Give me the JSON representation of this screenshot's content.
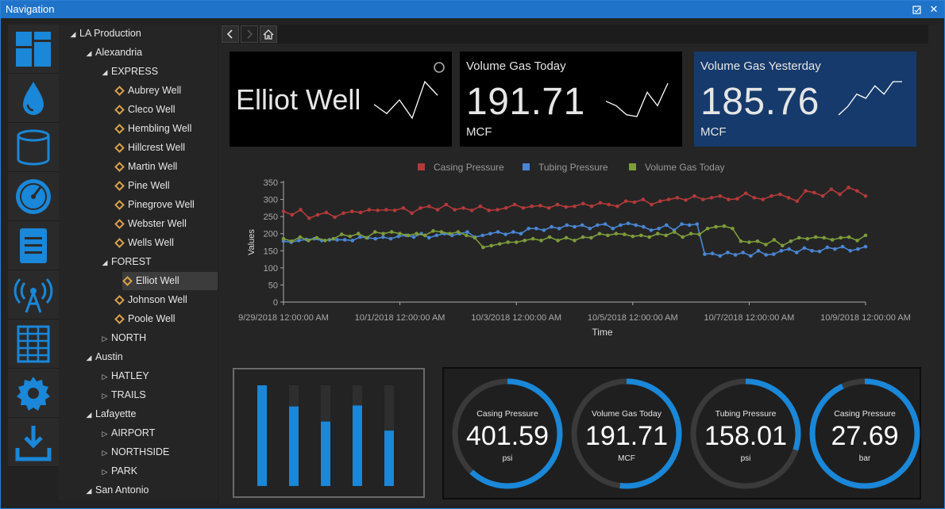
{
  "window": {
    "title": "Navigation"
  },
  "colors": {
    "accent": "#1a87d8",
    "tile_active": "#163a6b",
    "casing": "#b33a3a",
    "tubing": "#4a86d4",
    "volume": "#7e9c3a"
  },
  "sidebar": {
    "icons": [
      "dashboard-icon",
      "water-drop-icon",
      "tank-icon",
      "gauge-icon",
      "document-icon",
      "antenna-icon",
      "grid-table-icon",
      "gear-icon",
      "download-icon"
    ]
  },
  "tree": {
    "rows": [
      {
        "label": "LA Production",
        "level": 0,
        "expander": "open"
      },
      {
        "label": "Alexandria",
        "level": 1,
        "expander": "open"
      },
      {
        "label": "EXPRESS",
        "level": 2,
        "expander": "open"
      },
      {
        "label": "Aubrey Well",
        "level": 3,
        "expander": "leaf"
      },
      {
        "label": "Cleco Well",
        "level": 3,
        "expander": "leaf"
      },
      {
        "label": "Hembling Well",
        "level": 3,
        "expander": "leaf"
      },
      {
        "label": "Hillcrest Well",
        "level": 3,
        "expander": "leaf"
      },
      {
        "label": "Martin Well",
        "level": 3,
        "expander": "leaf"
      },
      {
        "label": "Pine Well",
        "level": 3,
        "expander": "leaf"
      },
      {
        "label": "Pinegrove Well",
        "level": 3,
        "expander": "leaf"
      },
      {
        "label": "Webster Well",
        "level": 3,
        "expander": "leaf"
      },
      {
        "label": "Wells Well",
        "level": 3,
        "expander": "leaf"
      },
      {
        "label": "FOREST",
        "level": 2,
        "expander": "open"
      },
      {
        "label": "Elliot Well",
        "level": 3,
        "expander": "leaf",
        "selected": true
      },
      {
        "label": "Johnson Well",
        "level": 3,
        "expander": "leaf"
      },
      {
        "label": "Poole Well",
        "level": 3,
        "expander": "leaf"
      },
      {
        "label": "NORTH",
        "level": 2,
        "expander": "closed"
      },
      {
        "label": "Austin",
        "level": 1,
        "expander": "open"
      },
      {
        "label": "HATLEY",
        "level": 2,
        "expander": "closed"
      },
      {
        "label": "TRAILS",
        "level": 2,
        "expander": "closed"
      },
      {
        "label": "Lafayette",
        "level": 1,
        "expander": "open"
      },
      {
        "label": "AIRPORT",
        "level": 2,
        "expander": "closed"
      },
      {
        "label": "NORTHSIDE",
        "level": 2,
        "expander": "closed"
      },
      {
        "label": "PARK",
        "level": 2,
        "expander": "closed"
      },
      {
        "label": "San Antonio",
        "level": 1,
        "expander": "open"
      }
    ]
  },
  "tiles": {
    "well": {
      "name": "Elliot Well",
      "spark": [
        4,
        2,
        5,
        1,
        9,
        6
      ]
    },
    "today": {
      "title": "Volume Gas Today",
      "value": "191.71",
      "unit": "MCF",
      "spark": [
        5,
        4,
        2,
        1.6,
        7,
        4,
        9
      ]
    },
    "yesterday": {
      "title": "Volume Gas Yesterday",
      "value": "185.76",
      "unit": "MCF",
      "spark": [
        1,
        3,
        6,
        5,
        8,
        6,
        9,
        9
      ]
    }
  },
  "chart_data": {
    "type": "line",
    "ylabel": "Values",
    "xlabel": "Time",
    "ylim": [
      0,
      350
    ],
    "yticks": [
      "0",
      "50",
      "100",
      "150",
      "200",
      "250",
      "300",
      "350"
    ],
    "xticks": [
      "9/29/2018 12:00:00 AM",
      "10/1/2018 12:00:00 AM",
      "10/3/2018 12:00:00 AM",
      "10/5/2018 12:00:00 AM",
      "10/7/2018 12:00:00 AM",
      "10/9/2018 12:00:00 AM"
    ],
    "legend_position": "top",
    "series": [
      {
        "name": "Casing Pressure",
        "values": [
          265,
          255,
          270,
          245,
          255,
          262,
          248,
          260,
          265,
          262,
          270,
          268,
          270,
          268,
          275,
          260,
          275,
          280,
          270,
          285,
          270,
          275,
          268,
          280,
          268,
          270,
          275,
          285,
          275,
          280,
          282,
          275,
          285,
          278,
          280,
          288,
          280,
          290,
          285,
          280,
          295,
          292,
          300,
          285,
          295,
          300,
          305,
          298,
          310,
          300,
          305,
          310,
          300,
          302,
          318,
          305,
          300,
          310,
          315,
          305,
          295,
          325,
          320,
          310,
          330,
          315,
          335,
          325,
          310
        ]
      },
      {
        "name": "Tubing Pressure",
        "values": [
          178,
          175,
          180,
          183,
          185,
          180,
          182,
          182,
          182,
          180,
          190,
          188,
          185,
          190,
          185,
          192,
          195,
          190,
          200,
          188,
          195,
          200,
          195,
          200,
          205,
          190,
          195,
          200,
          205,
          198,
          205,
          200,
          215,
          215,
          210,
          220,
          215,
          225,
          220,
          225,
          215,
          225,
          228,
          215,
          225,
          230,
          225,
          220,
          210,
          215,
          225,
          210,
          228,
          225,
          228,
          140,
          142,
          135,
          145,
          138,
          145,
          135,
          150,
          138,
          140,
          150,
          155,
          145,
          158,
          150,
          148,
          160,
          155,
          162,
          150,
          155,
          162
        ]
      },
      {
        "name": "Volume Gas Today",
        "values": [
          185,
          178,
          190,
          180,
          188,
          180,
          185,
          198,
          192,
          200,
          188,
          205,
          200,
          205,
          200,
          195,
          200,
          195,
          208,
          205,
          200,
          205,
          195,
          188,
          160,
          165,
          170,
          175,
          175,
          180,
          185,
          180,
          190,
          180,
          188,
          180,
          190,
          188,
          200,
          195,
          200,
          198,
          192,
          195,
          190,
          200,
          195,
          205,
          190,
          200,
          198,
          215,
          220,
          222,
          215,
          178,
          175,
          178,
          168,
          182,
          165,
          178,
          188,
          185,
          190,
          188,
          182,
          188,
          190,
          180,
          195
        ]
      }
    ]
  },
  "bars": {
    "levels": [
      1.0,
      0.79,
      0.64,
      0.8,
      0.55
    ]
  },
  "gauges": [
    {
      "title": "Casing Pressure",
      "value": "401.59",
      "unit": "psi",
      "fraction": 0.62
    },
    {
      "title": "Volume Gas Today",
      "value": "191.71",
      "unit": "MCF",
      "fraction": 0.52
    },
    {
      "title": "Tubing Pressure",
      "value": "158.01",
      "unit": "psi",
      "fraction": 0.3
    },
    {
      "title": "Casing Pressure",
      "value": "27.69",
      "unit": "bar",
      "fraction": 0.93
    }
  ]
}
